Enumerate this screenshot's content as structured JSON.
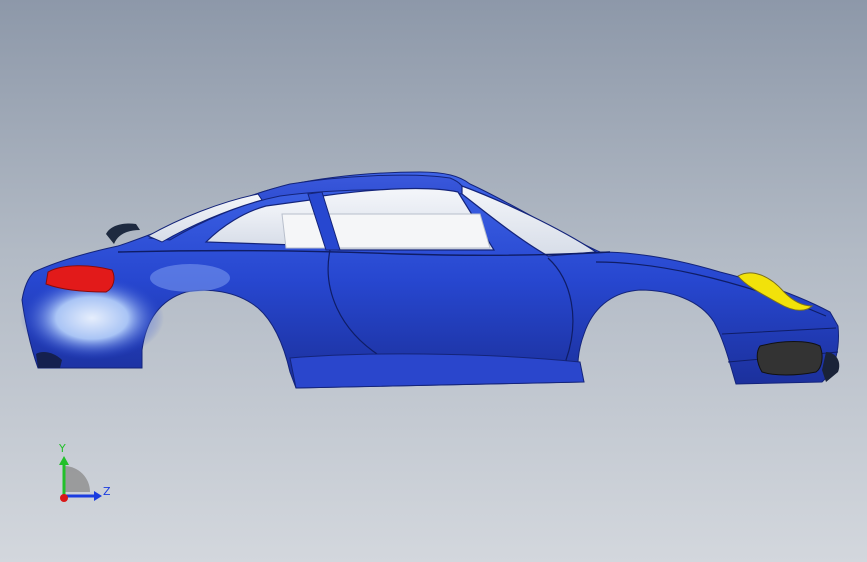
{
  "viewport": {
    "background_top": "#8d98a9",
    "background_bottom": "#d3d7dd"
  },
  "model": {
    "body_color": "#2747d0",
    "body_highlight": "#a9c4f5",
    "body_shadow": "#1b2f9a",
    "glass_color": "#e9eef6",
    "tail_light_color": "#e21a1a",
    "head_light_color": "#f2e20a",
    "fog_lamp_color": "#333333"
  },
  "triad": {
    "y_label": "Y",
    "z_label": "Z",
    "y_color": "#22c02a",
    "z_color": "#1a3ce0",
    "x_color": "#d81818",
    "icon": "coordinate-triad-icon"
  }
}
